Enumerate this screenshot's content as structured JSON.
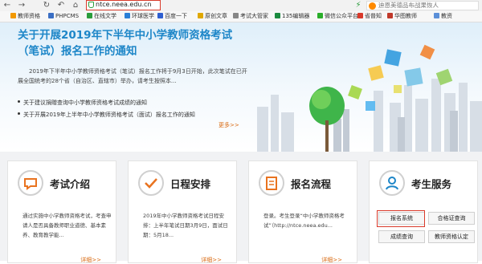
{
  "browser": {
    "address": "ntce.neea.edu.cn",
    "search_placeholder": "迪恩美德品布战果恢人"
  },
  "bookmarks": [
    "教师资格",
    "PHPCMS",
    "在线文学",
    "环球医学",
    "百度一下",
    "原创文章",
    "考试大管家",
    "135编辑器",
    "微信公众平台",
    "省普知",
    "华图教师",
    "教资"
  ],
  "hero": {
    "title": "关于开展2019年下半年中小学教师资格考试（笔试）报名工作的通知",
    "body": "2019年下半年中小学教师资格考试（笔试）报名工作将于9月3日开始，此次笔试在已开展全国统考的28个省（自治区、直辖市）举办，请考生按照本...",
    "notices": [
      "关于建议捐赠查询中小学教师资格考试成绩的通知",
      "关于开展2019年上半年中小学教师资格考试（面试）报名工作的通知"
    ],
    "more": "更多>>"
  },
  "cards": [
    {
      "title": "考试介绍",
      "desc": "通过实施中小学教师资格考试，考查申请人是否具备教师职业道德、基本素养、教育教学能...",
      "more": "详细>>"
    },
    {
      "title": "日程安排",
      "desc": "2019年中小学教师资格考试日程安排：上半年笔试日期3月9日，面试日期：5月18...",
      "more": "详细>>"
    },
    {
      "title": "报名流程",
      "desc": "登录。考生登录“中小学教师资格考试”（http://ntce.neea.edu...",
      "more": "详细>>"
    },
    {
      "title": "考生服务"
    }
  ],
  "services": [
    "报名系统",
    "合格证查询",
    "成绩查询",
    "教师资格认定"
  ],
  "colors": {
    "accent_blue": "#1d86c8",
    "more_orange": "#d96a12",
    "highlight_red": "#d93a2b"
  }
}
